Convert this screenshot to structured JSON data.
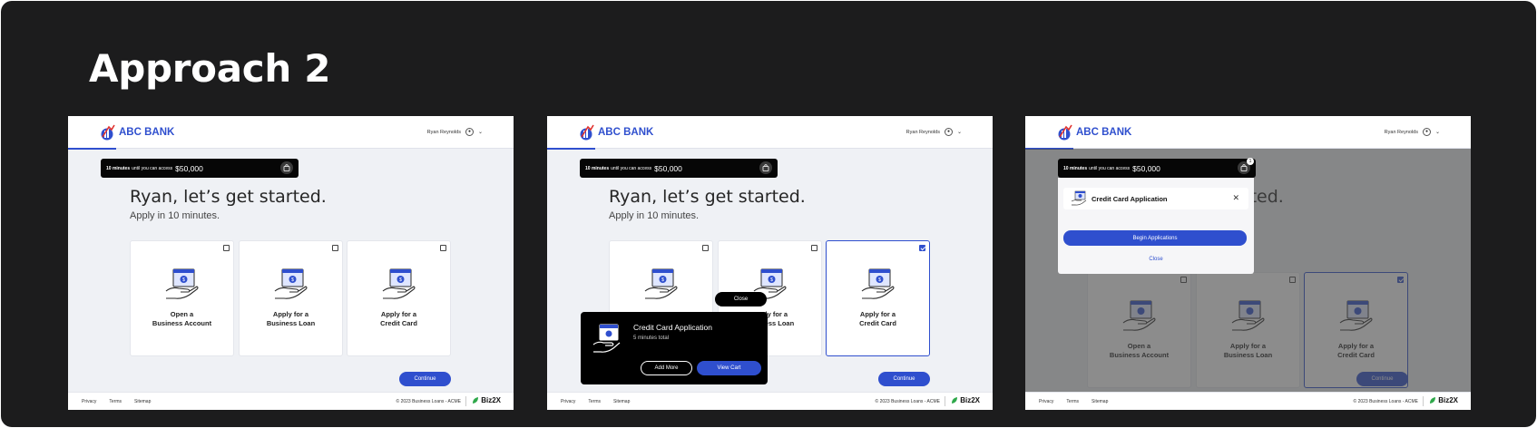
{
  "board_title": "Approach 2",
  "app": {
    "bank_name": "ABC BANK",
    "user_name": "Ryan Reynolds",
    "timer_bold": "10 minutes",
    "timer_text": "until you can access",
    "timer_amount": "$50,000",
    "cart_count": "1",
    "greeting": "Ryan, let’s get started.",
    "subheading": "Apply in 10 minutes.",
    "options": [
      {
        "line1": "Open a",
        "line2": "Business Account"
      },
      {
        "line1": "Apply for a",
        "line2": "Business Loan"
      },
      {
        "line1": "Apply for a",
        "line2": "Credit Card"
      }
    ],
    "continue_label": "Continue",
    "footer": {
      "links": [
        "Privacy",
        "Terms",
        "Sitemap"
      ],
      "copyright": "© 2023 Business Loans - ACME",
      "brand": "Biz2X"
    },
    "brand_color": "#2f4fce"
  },
  "cart_popup": {
    "close_label": "Close",
    "title": "Credit Card Application",
    "subtitle": "5 minutes total",
    "add_more_label": "Add More",
    "view_cart_label": "View Cart"
  },
  "cart_modal": {
    "item_title": "Credit Card Application",
    "begin_label": "Begin Applications",
    "close_label": "Close"
  }
}
